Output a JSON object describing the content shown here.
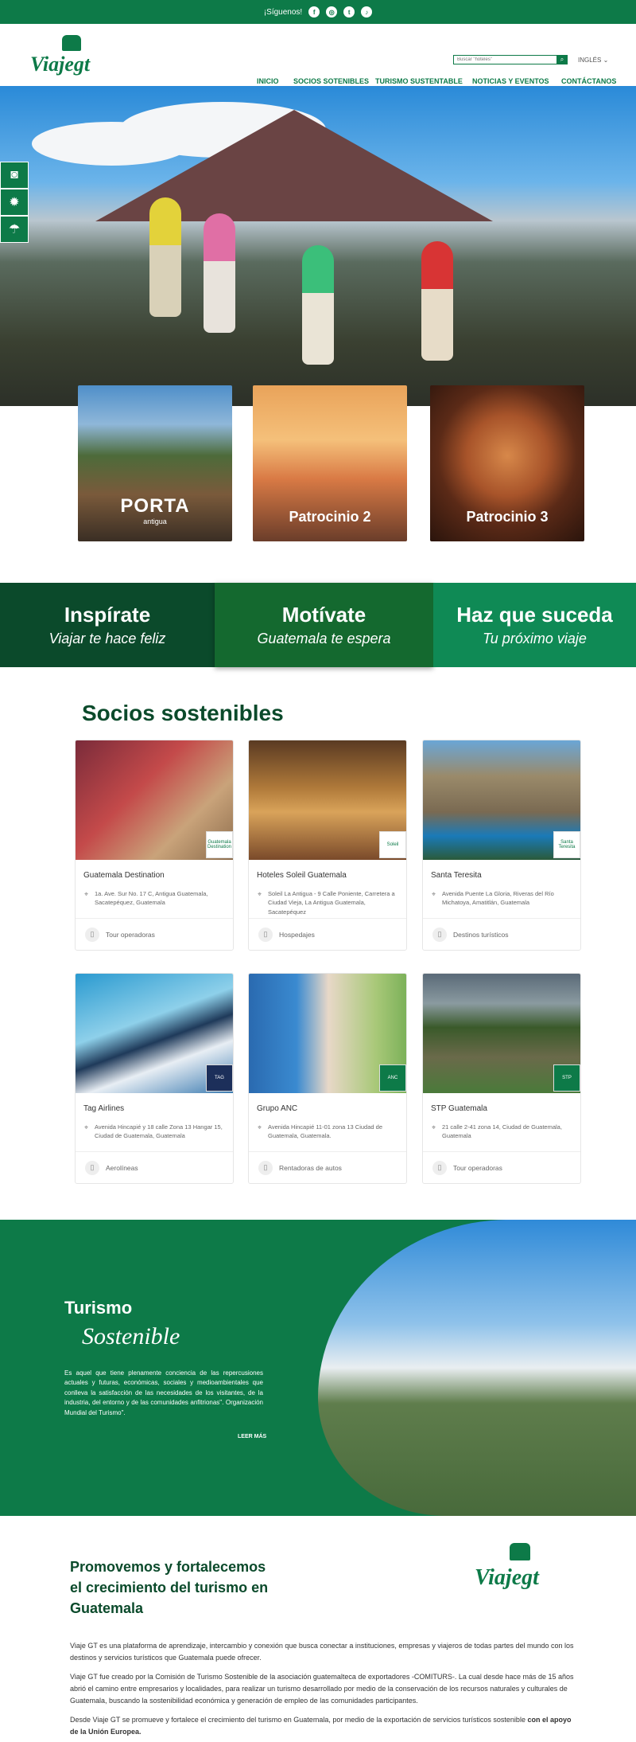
{
  "topbar": {
    "follow_label": "¡Síguenos!",
    "social": [
      "facebook-icon",
      "instagram-icon",
      "twitter-icon",
      "tiktok-icon"
    ]
  },
  "header": {
    "logo_text": "Viajegt",
    "search_placeholder": "Buscar \"hoteles\"",
    "language": "INGLÉS",
    "nav": [
      "INICIO",
      "SOCIOS SOTENIBLES",
      "TURISMO SUSTENTABLE",
      "NOTICIAS Y EVENTOS",
      "CONTÁCTANOS"
    ]
  },
  "promos": [
    {
      "label": "PORTA",
      "sub": "antigua"
    },
    {
      "label": "Patrocinio 2"
    },
    {
      "label": "Patrocinio 3"
    }
  ],
  "banners": [
    {
      "title": "Inspírate",
      "subtitle": "Viajar te hace feliz"
    },
    {
      "title": "Motívate",
      "subtitle": "Guatemala te espera"
    },
    {
      "title": "Haz que suceda",
      "subtitle": "Tu próximo viaje"
    }
  ],
  "socios": {
    "title": "Socios sostenibles",
    "cards": [
      {
        "name": "Guatemala Destination",
        "address": "1a. Ave. Sur No. 17 C, Antigua Guatemala, Sacatepéquez, Guatemala",
        "category": "Tour operadoras",
        "badge": "Guatemala Destination"
      },
      {
        "name": "Hoteles Soleil Guatemala",
        "address": "Soleil La Antigua - 9 Calle Poniente, Carretera a Ciudad Vieja, La Antigua Guatemala, Sacatepéquez",
        "category": "Hospedajes",
        "badge": "Soleil"
      },
      {
        "name": "Santa Teresita",
        "address": "Avenida Puente La Gloria, Riveras del Río Michatoya, Amatitlán, Guatemala",
        "category": "Destinos turísticos",
        "badge": "Santa Teresita"
      },
      {
        "name": "Tag Airlines",
        "address": "Avenida Hincapié y 18 calle Zona 13 Hangar 15, Ciudad de Guatemala, Guatemala",
        "category": "Aerolíneas",
        "badge": "TAG"
      },
      {
        "name": "Grupo ANC",
        "address": "Avenida Hincapié 11-01 zona 13 Ciudad de Guatemala, Guatemala.",
        "category": "Rentadoras de autos",
        "badge": "ANC"
      },
      {
        "name": "STP Guatemala",
        "address": "21 calle 2-41 zona 14, Ciudad de Guatemala, Guatemala",
        "category": "Tour operadoras",
        "badge": "STP"
      }
    ]
  },
  "turismo": {
    "title": "Turismo",
    "script": "Sostenible",
    "body": "Es aquel que tiene plenamente conciencia de las repercusiones actuales y futuras, económicas, sociales y medioambientales que conlleva la satisfacción de las necesidades de los visitantes, de la industria, del entorno y de las comunidades anfitrionas\". Organización Mundial del Turismo\".",
    "more": "LEER MÁS"
  },
  "about": {
    "title": "Promovemos y fortalecemos el crecimiento del turismo en Guatemala",
    "p1": "Viaje GT es una plataforma de aprendizaje, intercambio y conexión que busca conectar a instituciones, empresas y viajeros de todas partes del mundo con los destinos y servicios turísticos que Guatemala puede ofrecer.",
    "p2": "Viaje GT fue creado por la Comisión de Turismo Sostenible de la asociación guatemalteca de exportadores -COMITURS-. La cual desde hace más de 15 años abrió el camino entre empresarios y localidades, para realizar un turismo desarrollado por medio de la conservación de los recursos naturales y culturales de Guatemala, buscando la sostenibilidad económica y generación de empleo de las comunidades participantes.",
    "p3": "Desde Viaje GT se promueve y fortalece el crecimiento del turismo en Guatemala, por medio de la exportación de servicios turísticos sostenible",
    "p3_bold": "con el apoyo de la Unión Europea."
  }
}
